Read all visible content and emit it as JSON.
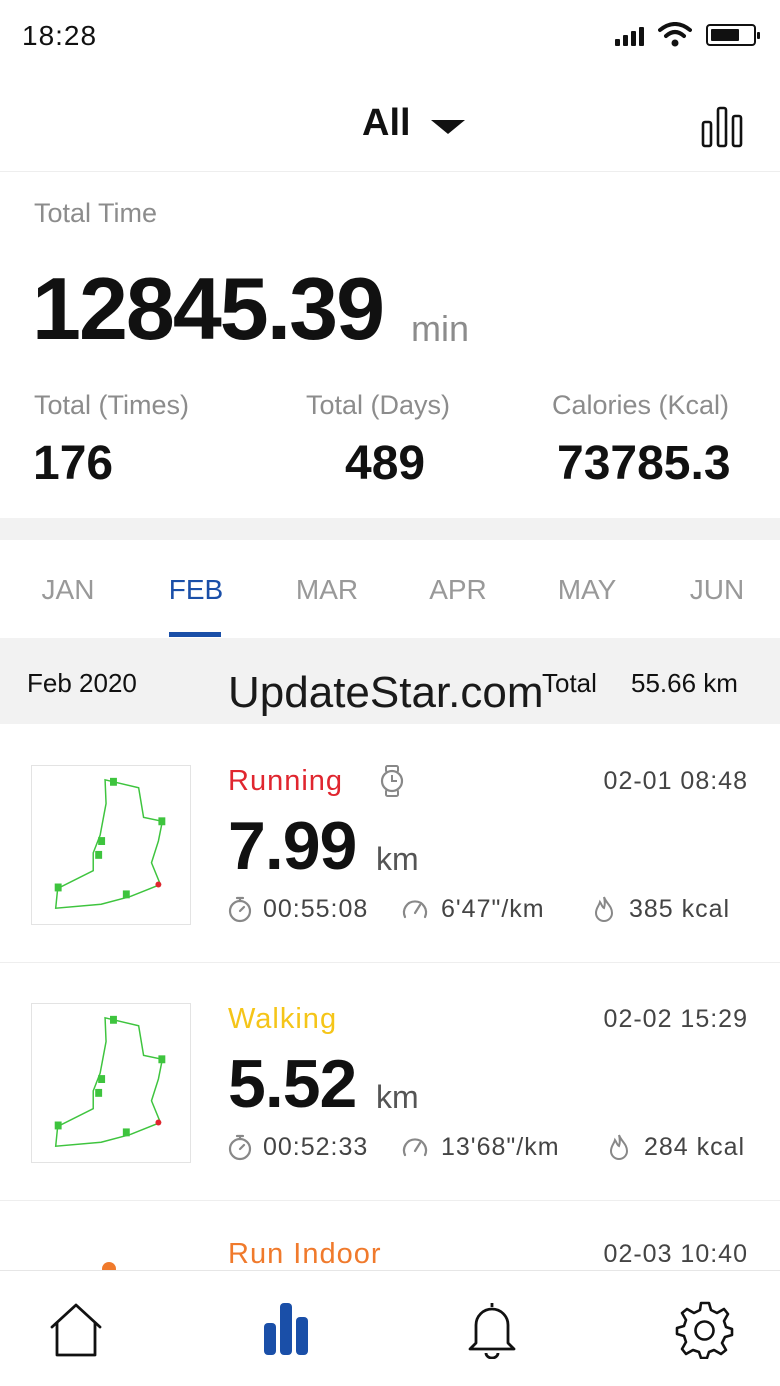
{
  "status_bar": {
    "time": "18:28"
  },
  "header": {
    "filter_label": "All"
  },
  "summary": {
    "total_time_label": "Total Time",
    "total_time_value": "12845.39",
    "total_time_unit": "min",
    "stats": [
      {
        "label": "Total (Times)",
        "value": "176"
      },
      {
        "label": "Total (Days)",
        "value": "489"
      },
      {
        "label": "Calories (Kcal)",
        "value": "73785.3"
      }
    ]
  },
  "month_tabs": {
    "items": [
      "JAN",
      "FEB",
      "MAR",
      "APR",
      "MAY",
      "JUN"
    ],
    "active": "FEB"
  },
  "month_header": {
    "month": "Feb 2020",
    "total_label": "Total",
    "total_value": "55.66 km"
  },
  "watermark": "UpdateStar.com",
  "activities": [
    {
      "type": "Running",
      "type_color": "#e0262f",
      "datetime": "02-01  08:48",
      "distance": "7.99",
      "unit": "km",
      "duration": "00:55:08",
      "pace": "6'47\"/km",
      "calories": "385 kcal"
    },
    {
      "type": "Walking",
      "type_color": "#f5c518",
      "datetime": "02-02  15:29",
      "distance": "5.52",
      "unit": "km",
      "duration": "00:52:33",
      "pace": "13'68\"/km",
      "calories": "284 kcal"
    },
    {
      "type": "Run Indoor",
      "type_color": "#f07a2c",
      "datetime": "02-03  10:40"
    }
  ],
  "bottom_nav": {
    "items": [
      "home-icon",
      "stats-icon",
      "bell-icon",
      "gear-icon"
    ],
    "active": "stats-icon",
    "active_color": "#1a4fa8"
  }
}
